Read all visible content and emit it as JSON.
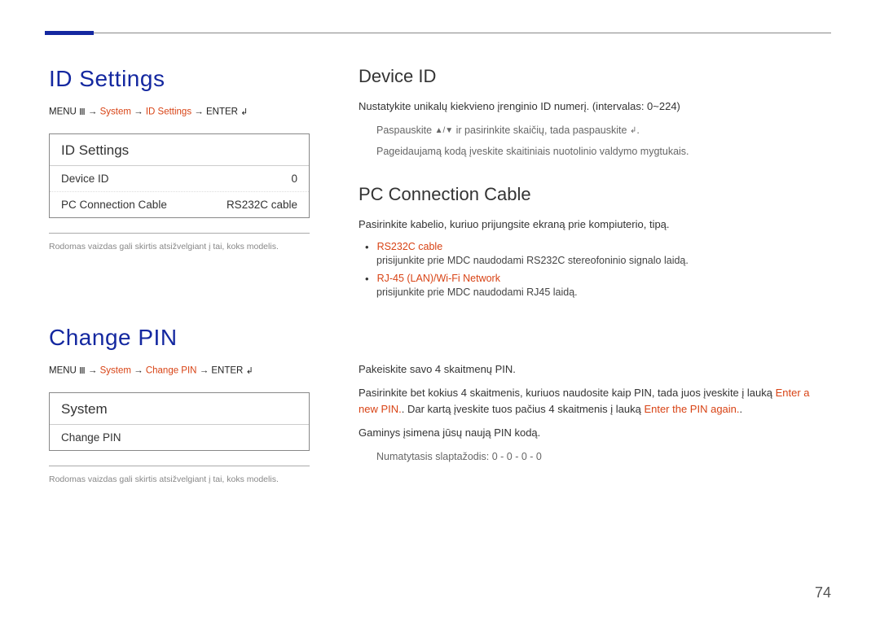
{
  "page_number": "74",
  "left": {
    "section1": {
      "title": "ID Settings",
      "breadcrumb": {
        "menu": "MENU",
        "icon1": "Ⅲ",
        "arrow": "→",
        "system": "System",
        "id_settings": "ID Settings",
        "enter": "ENTER",
        "icon2": "↲"
      },
      "panel_title": "ID Settings",
      "row1_label": "Device ID",
      "row1_value": "0",
      "row2_label": "PC Connection Cable",
      "row2_value": "RS232C cable",
      "caption": "Rodomas vaizdas gali skirtis atsižvelgiant į tai, koks modelis."
    },
    "section2": {
      "title": "Change PIN",
      "breadcrumb": {
        "menu": "MENU",
        "icon1": "Ⅲ",
        "arrow": "→",
        "system": "System",
        "change_pin": "Change PIN",
        "enter": "ENTER",
        "icon2": "↲"
      },
      "panel_title": "System",
      "row1_label": "Change PIN",
      "caption": "Rodomas vaizdas gali skirtis atsižvelgiant į tai, koks modelis."
    }
  },
  "right": {
    "device_id": {
      "title": "Device ID",
      "body": "Nustatykite unikalų kiekvieno įrenginio ID numerį. (intervalas: 0~224)",
      "sub1_pre": "Paspauskite ",
      "sub1_icons": "▲/▼",
      "sub1_mid": " ir pasirinkite skaičių, tada paspauskite ",
      "sub1_icon2": "↲",
      "sub1_end": ".",
      "sub2": "Pageidaujamą kodą įveskite skaitiniais nuotolinio valdymo mygtukais."
    },
    "pc_conn": {
      "title": "PC Connection Cable",
      "body": "Pasirinkite kabelio, kuriuo prijungsite ekraną prie kompiuterio, tipą.",
      "b1_label": "RS232C cable",
      "b1_text": "prisijunkite prie MDC naudodami RS232C stereofoninio signalo laidą.",
      "b2_label": "RJ-45 (LAN)/Wi-Fi Network",
      "b2_text": "prisijunkite prie MDC naudodami RJ45 laidą."
    },
    "change_pin": {
      "p1": "Pakeiskite savo 4 skaitmenų PIN.",
      "p2_a": "Pasirinkite bet kokius 4 skaitmenis, kuriuos naudosite kaip PIN, tada juos įveskite į lauką ",
      "p2_red1": "Enter a new PIN.",
      "p2_b": ". Dar kartą įveskite tuos pačius 4 skaitmenis į lauką ",
      "p2_red2": "Enter the PIN again.",
      "p2_c": ".",
      "p3": "Gaminys įsimena jūsų naują PIN kodą.",
      "p4": "Numatytasis slaptažodis: 0 - 0 - 0 - 0"
    }
  }
}
